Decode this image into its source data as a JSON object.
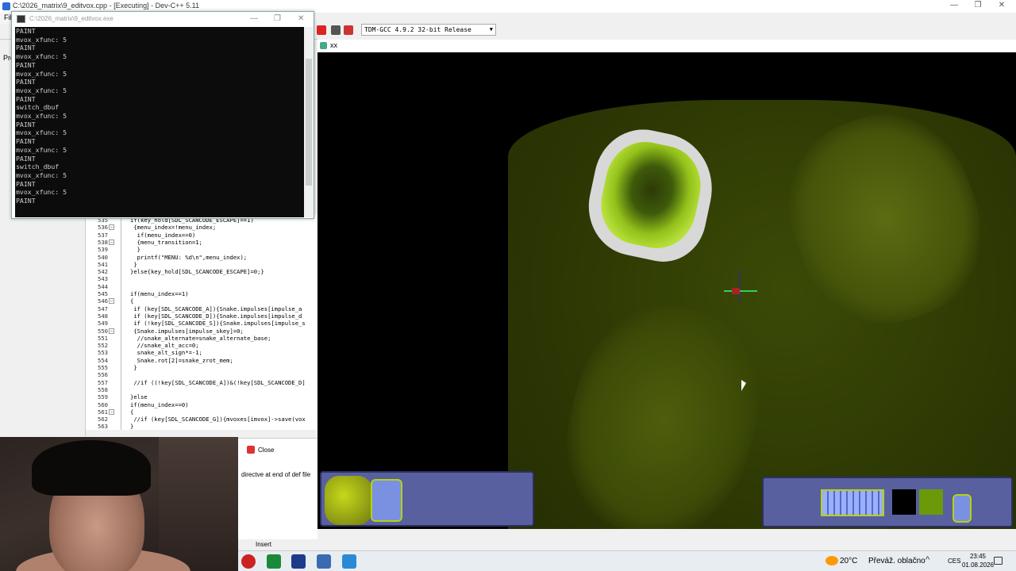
{
  "ide": {
    "title": "C:\\2026_matrix\\9_editvox.cpp - [Executing] - Dev-C++ 5.11",
    "menu_file": "File",
    "projects_label": "Pro",
    "compiler": "TDM-GCC 4.9.2 32-bit Release",
    "min_glyph": "—",
    "max_glyph": "❐",
    "close_glyph": "✕"
  },
  "console": {
    "title": "C:\\2026_matrix\\9_editvox.exe",
    "lines": [
      "PAINT",
      "mvox_xfunc: 5",
      "PAINT",
      "mvox_xfunc: 5",
      "PAINT",
      "mvox_xfunc: 5",
      "PAINT",
      "mvox_xfunc: 5",
      "PAINT",
      "switch_dbuf",
      "mvox_xfunc: 5",
      "PAINT",
      "mvox_xfunc: 5",
      "PAINT",
      "mvox_xfunc: 5",
      "PAINT",
      "switch_dbuf",
      "mvox_xfunc: 5",
      "PAINT",
      "mvox_xfunc: 5",
      "PAINT"
    ]
  },
  "editor": {
    "lines": [
      {
        "n": "535",
        "fold": "",
        "code": "if(key_hold[SDL_SCANCODE_ESCAPE]==1)"
      },
      {
        "n": "536",
        "fold": "−",
        "code": " {menu_index=!menu_index;"
      },
      {
        "n": "537",
        "fold": "",
        "code": "  if(menu_index==0)"
      },
      {
        "n": "538",
        "fold": "−",
        "code": "  {menu_transition=1;"
      },
      {
        "n": "539",
        "fold": "",
        "code": "  }"
      },
      {
        "n": "540",
        "fold": "",
        "code": "  printf(\"MENU: %d\\n\",menu_index);"
      },
      {
        "n": "541",
        "fold": "",
        "code": " }"
      },
      {
        "n": "542",
        "fold": "",
        "code": "}else{key_hold[SDL_SCANCODE_ESCAPE]=0;}"
      },
      {
        "n": "543",
        "fold": "",
        "code": ""
      },
      {
        "n": "544",
        "fold": "",
        "code": ""
      },
      {
        "n": "545",
        "fold": "",
        "code": "if(menu_index==1)"
      },
      {
        "n": "546",
        "fold": "−",
        "code": "{"
      },
      {
        "n": "547",
        "fold": "",
        "code": " if (key[SDL_SCANCODE_A]){Snake.impulses[impulse_a"
      },
      {
        "n": "548",
        "fold": "",
        "code": " if (key[SDL_SCANCODE_D]){Snake.impulses[impulse_d"
      },
      {
        "n": "549",
        "fold": "",
        "code": " if (!key[SDL_SCANCODE_S]){Snake.impulses[impulse_s"
      },
      {
        "n": "550",
        "fold": "−",
        "code": " {Snake.impulses[impulse_skey]=0;"
      },
      {
        "n": "551",
        "fold": "",
        "code": "  //snake_alternate=snake_alternate_base;"
      },
      {
        "n": "552",
        "fold": "",
        "code": "  //snake_alt_acc=0;"
      },
      {
        "n": "553",
        "fold": "",
        "code": "  snake_alt_sign*=-1;"
      },
      {
        "n": "554",
        "fold": "",
        "code": "  Snake.rot[2]=snake_zrot_mem;"
      },
      {
        "n": "555",
        "fold": "",
        "code": " }"
      },
      {
        "n": "556",
        "fold": "",
        "code": ""
      },
      {
        "n": "557",
        "fold": "",
        "code": " //if ((!key[SDL_SCANCODE_A])&(!key[SDL_SCANCODE_D]"
      },
      {
        "n": "558",
        "fold": "",
        "code": ""
      },
      {
        "n": "559",
        "fold": "",
        "code": "}else"
      },
      {
        "n": "560",
        "fold": "",
        "code": "if(menu_index==0)"
      },
      {
        "n": "561",
        "fold": "−",
        "code": "{"
      },
      {
        "n": "562",
        "fold": "",
        "code": " //if (key[SDL_SCANCODE_G]){mvoxes[imvox]->save(vox"
      },
      {
        "n": "563",
        "fold": "",
        "code": "}"
      }
    ]
  },
  "log": {
    "close_label": "Close",
    "message": "directve at end of def file"
  },
  "status": {
    "mode": "Insert"
  },
  "game": {
    "title": "xx"
  },
  "taskbar": {
    "temperature": "20°C",
    "weather": "Převáž. oblačno",
    "chevron": "^",
    "language": "CES",
    "time": "23:45",
    "date": "01.08.2026"
  },
  "colors": {
    "voxel_green": "#b7e03a",
    "hud_blue": "#5860a0"
  }
}
